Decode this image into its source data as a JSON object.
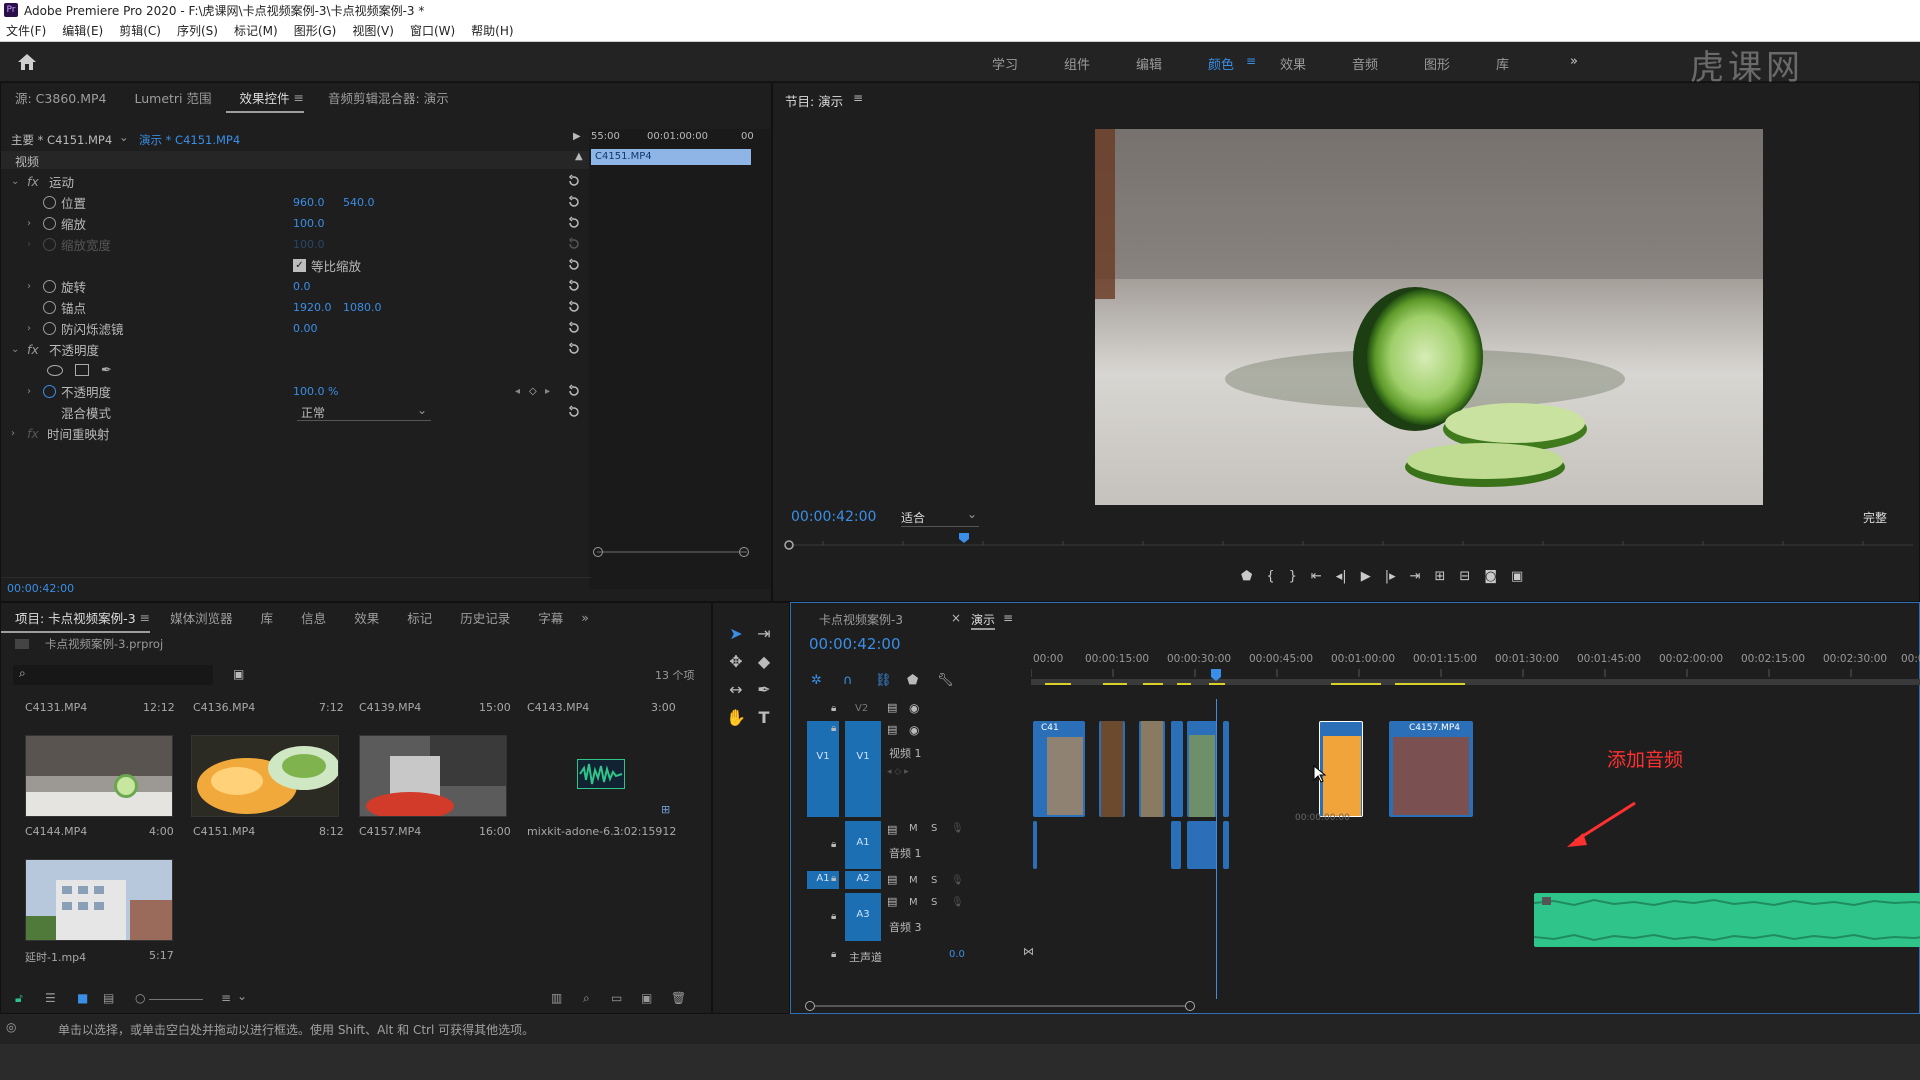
{
  "window": {
    "title": "Adobe Premiere Pro 2020 - F:\\虎课网\\卡点视频案例-3\\卡点视频案例-3 *",
    "app_badge": "Pr"
  },
  "menu": [
    "文件(F)",
    "编辑(E)",
    "剪辑(C)",
    "序列(S)",
    "标记(M)",
    "图形(G)",
    "视图(V)",
    "窗口(W)",
    "帮助(H)"
  ],
  "workspaces": [
    "学习",
    "组件",
    "编辑",
    "颜色",
    "效果",
    "音频",
    "图形",
    "库"
  ],
  "active_workspace": "颜色",
  "workspace_more": "»",
  "watermark": "虎课网",
  "effect_panel": {
    "tabs": [
      "源: C3860.MP4",
      "Lumetri 范围",
      "效果控件",
      "音频剪辑混合器: 演示"
    ],
    "active_tab": "效果控件",
    "master_clip": "主要 * C4151.MP4",
    "sequence_clip": "演示 * C4151.MP4",
    "mini_timeline": {
      "t1": "55:00",
      "t2": "00:01:00:00",
      "t3": "00",
      "clip": "C4151.MP4"
    },
    "video_header": "视频",
    "motion": "运动",
    "position": {
      "label": "位置",
      "x": "960.0",
      "y": "540.0"
    },
    "scale": {
      "label": "缩放",
      "value": "100.0"
    },
    "scale_width": {
      "label": "缩放宽度",
      "value": "100.0"
    },
    "uniform_scale": "等比缩放",
    "rotation": {
      "label": "旋转",
      "value": "0.0"
    },
    "anchor": {
      "label": "锚点",
      "x": "1920.0",
      "y": "1080.0"
    },
    "flicker": {
      "label": "防闪烁滤镜",
      "value": "0.00"
    },
    "opacity_group": "不透明度",
    "opacity": {
      "label": "不透明度",
      "value": "100.0 %"
    },
    "blend_mode": {
      "label": "混合模式",
      "value": "正常"
    },
    "time_remap": "时间重映射",
    "timecode": "00:00:42:00"
  },
  "program": {
    "title": "节目: 演示",
    "timecode": "00:00:42:00",
    "fit": "适合",
    "quality": "完整"
  },
  "project": {
    "tabs": [
      "项目: 卡点视频案例-3",
      "媒体浏览器",
      "库",
      "信息",
      "效果",
      "标记",
      "历史记录",
      "字幕"
    ],
    "active_tab": "项目: 卡点视频案例-3",
    "file": "卡点视频案例-3.prproj",
    "item_count": "13 个项",
    "row1_labels": [
      {
        "name": "C4131.MP4",
        "dur": "12:12"
      },
      {
        "name": "C4136.MP4",
        "dur": "7:12"
      },
      {
        "name": "C4139.MP4",
        "dur": "15:00"
      },
      {
        "name": "C4143.MP4",
        "dur": "3:00"
      }
    ],
    "row2_labels": [
      {
        "name": "C4144.MP4",
        "dur": "4:00"
      },
      {
        "name": "C4151.MP4",
        "dur": "8:12"
      },
      {
        "name": "C4157.MP4",
        "dur": "16:00"
      },
      {
        "name": "mixkit-adone-6...",
        "dur": "3:02:15912"
      }
    ],
    "row3_labels": [
      {
        "name": "延时-1.mp4",
        "dur": "5:17"
      }
    ]
  },
  "timeline": {
    "tabs": [
      "卡点视频案例-3",
      "演示"
    ],
    "active_tab": "演示",
    "timecode": "00:00:42:00",
    "ruler": [
      "00:00",
      "00:00:15:00",
      "00:00:30:00",
      "00:00:45:00",
      "00:01:00:00",
      "00:01:15:00",
      "00:01:30:00",
      "00:01:45:00",
      "00:02:00:00",
      "00:02:15:00",
      "00:02:30:00",
      "00:02"
    ],
    "tracks": {
      "v2": "V2",
      "v1": "V1",
      "v1_name": "视频 1",
      "a1": "A1",
      "a1_name": "音频 1",
      "a2": "A2",
      "a3": "A3",
      "a3_name": "音频 3",
      "master": "主声道",
      "master_val": "0.0"
    },
    "clip_labels": [
      "C41",
      "C4157.MP4"
    ],
    "clip_ghost": "00:00:00:00",
    "annotation": "添加音频"
  },
  "status": "单击以选择，或单击空白处并拖动以进行框选。使用 Shift、Alt 和 Ctrl 可获得其他选项。",
  "colors": {
    "accent": "#3a8ee6",
    "audio": "#2fc48a",
    "annotation": "#ff3030",
    "clip_blue": "#1c6fb3"
  }
}
